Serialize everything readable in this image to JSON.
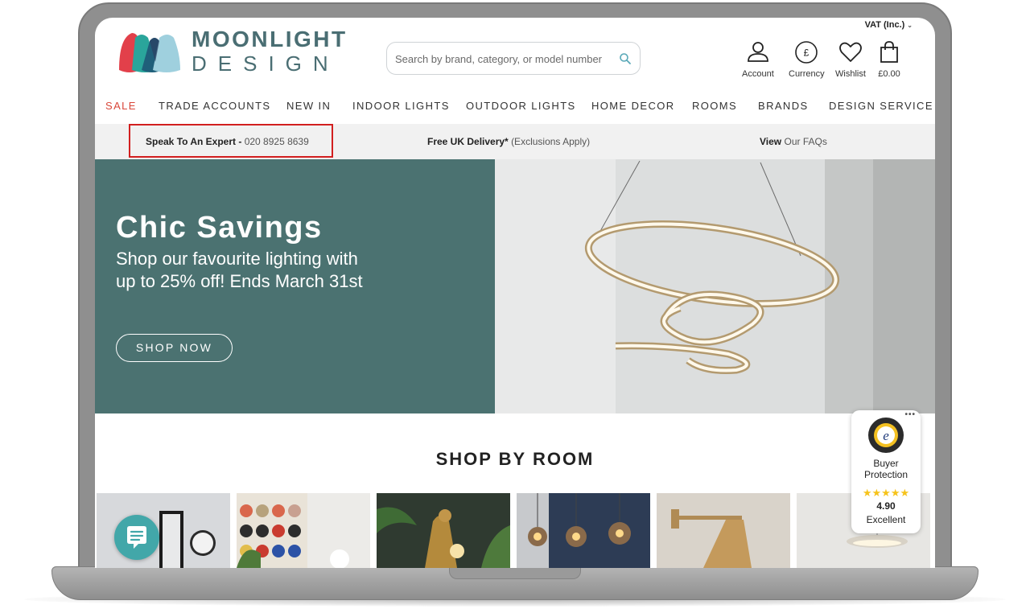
{
  "header": {
    "vat_label": "VAT (Inc.)",
    "logo_line1": "MOONLIGHT",
    "logo_line2": "DESIGN",
    "search_placeholder": "Search by brand, category, or model number",
    "actions": [
      {
        "label": "Account",
        "icon": "user-icon"
      },
      {
        "label": "Currency",
        "icon": "currency-pound-icon"
      },
      {
        "label": "Wishlist",
        "icon": "heart-icon"
      },
      {
        "label": "£0.00",
        "icon": "shopping-bag-icon"
      }
    ],
    "currency_symbol": "£"
  },
  "nav": {
    "items": [
      "SALE",
      "TRADE ACCOUNTS",
      "NEW IN",
      "INDOOR LIGHTS",
      "OUTDOOR LIGHTS",
      "HOME DECOR",
      "ROOMS",
      "BRANDS",
      "DESIGN SERVICE"
    ],
    "sale_color": "#d9473a"
  },
  "infobar": {
    "expert_bold": "Speak To An Expert -",
    "expert_phone": "020 8925 8639",
    "delivery_bold": "Free UK Delivery*",
    "delivery_rest": "(Exclusions Apply)",
    "faq_bold": "View",
    "faq_rest": "Our FAQs",
    "highlight_color": "#d21f1f"
  },
  "hero": {
    "title": "Chic Savings",
    "subtitle": "Shop our favourite lighting with up to 25% off! Ends March 31st",
    "button": "SHOP NOW",
    "panel_color": "#4b7271"
  },
  "rooms": {
    "title": "SHOP BY ROOM"
  },
  "trusted_shops": {
    "dots": "•••",
    "seal_letter": "e",
    "line1": "Buyer",
    "line2": "Protection",
    "stars": "★★★★★",
    "score": "4.90",
    "rating": "Excellent"
  },
  "colors": {
    "brand_teal": "#4a6e73",
    "chat_bubble": "#42a7a9",
    "star": "#f6c31b"
  }
}
